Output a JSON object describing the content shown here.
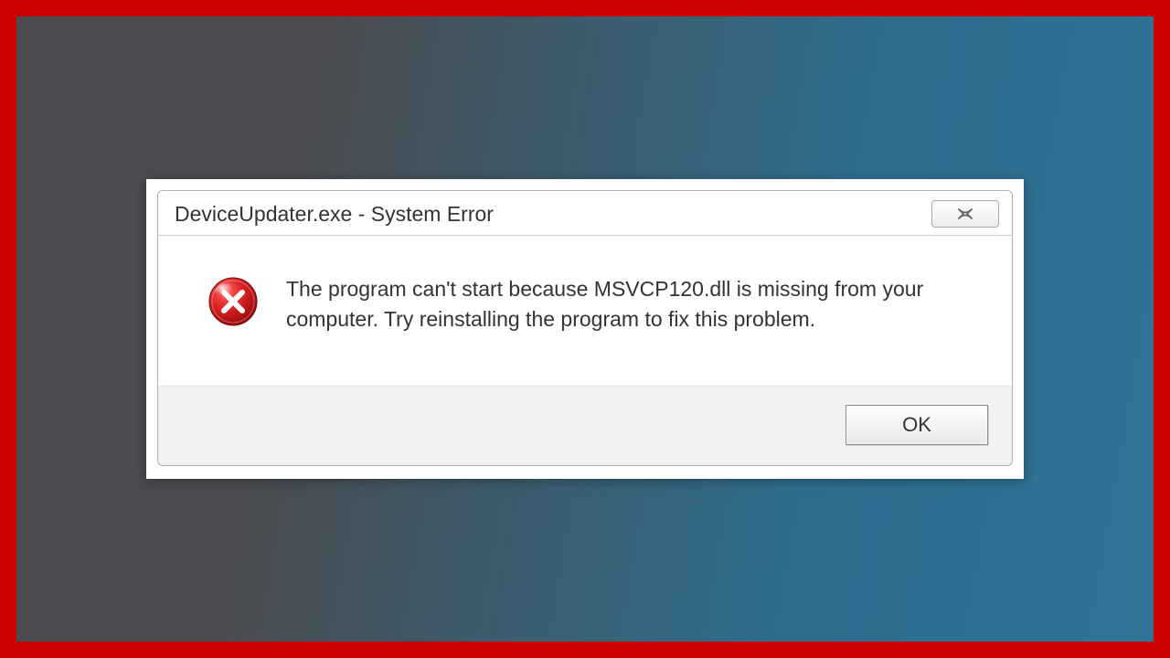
{
  "dialog": {
    "title": "DeviceUpdater.exe - System Error",
    "close_label": "✕",
    "message": "The program can't start because MSVCP120.dll is missing from your computer. Try reinstalling the program to fix this problem.",
    "ok_label": "OK"
  }
}
